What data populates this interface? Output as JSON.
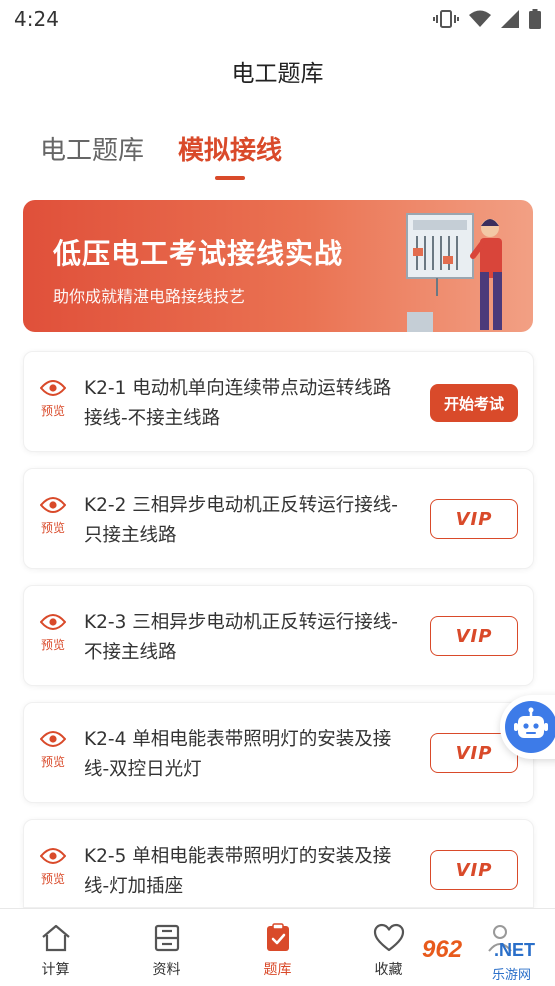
{
  "status_bar": {
    "time": "4:24"
  },
  "header": {
    "title": "电工题库"
  },
  "tabs": [
    {
      "label": "电工题库",
      "active": false
    },
    {
      "label": "模拟接线",
      "active": true
    }
  ],
  "banner": {
    "title": "低压电工考试接线实战",
    "subtitle": "助你成就精湛电路接线技艺"
  },
  "items": [
    {
      "title": "K2-1 电动机单向连续带点动运转线路接线-不接主线路",
      "preview_label": "预览",
      "action_label": "开始考试",
      "action_type": "exam"
    },
    {
      "title": "K2-2 三相异步电动机正反转运行接线-只接主线路",
      "preview_label": "预览",
      "action_label": "VIP",
      "action_type": "vip"
    },
    {
      "title": "K2-3 三相异步电动机正反转运行接线-不接主线路",
      "preview_label": "预览",
      "action_label": "VIP",
      "action_type": "vip"
    },
    {
      "title": "K2-4 单相电能表带照明灯的安装及接线-双控日光灯",
      "preview_label": "预览",
      "action_label": "VIP",
      "action_type": "vip"
    },
    {
      "title": "K2-5 单相电能表带照明灯的安装及接线-灯加插座",
      "preview_label": "预览",
      "action_label": "VIP",
      "action_type": "vip"
    }
  ],
  "bottom_nav": [
    {
      "label": "计算",
      "icon": "home-icon",
      "active": false
    },
    {
      "label": "资料",
      "icon": "book-icon",
      "active": false
    },
    {
      "label": "题库",
      "icon": "clipboard-check-icon",
      "active": true
    },
    {
      "label": "收藏",
      "icon": "heart-icon",
      "active": false
    },
    {
      "label": "",
      "icon": "user-icon",
      "active": false
    }
  ],
  "watermark": {
    "brand": "962",
    "domain": ".NET",
    "sub": "乐游网"
  },
  "colors": {
    "accent": "#d94a2a",
    "banner_start": "#e0503a",
    "banner_end": "#f2a084",
    "fab": "#3d7be8"
  }
}
